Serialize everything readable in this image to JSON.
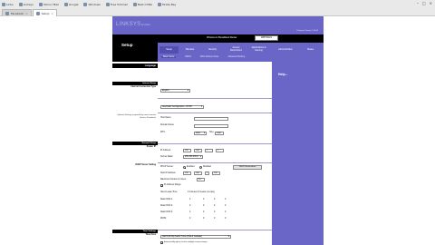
{
  "browser": {
    "bookmarks": [
      {
        "label": "Links"
      },
      {
        "label": "Linksys"
      },
      {
        "label": "Yahoo! Mail"
      },
      {
        "label": "Google"
      },
      {
        "label": "Windows"
      },
      {
        "label": "Free Hotmail"
      },
      {
        "label": "Best CCNA"
      },
      {
        "label": "Pirate Bay"
      }
    ],
    "tabs": [
      {
        "label": "Facebook",
        "active": false
      },
      {
        "label": "Setup",
        "active": true
      }
    ]
  },
  "router": {
    "brand": "LINKSYS",
    "brand_sub": "by Cisco",
    "firmware": "Firmware Version: 1.00.00",
    "section_title": "Setup",
    "product_name": "Wireless-G Broadband Router",
    "model": "WRT54GS",
    "nav_tabs": [
      {
        "label": "Setup",
        "active": true
      },
      {
        "label": "Wireless",
        "active": false
      },
      {
        "label": "Security",
        "active": false
      },
      {
        "label": "Access Restrictions",
        "active": false
      },
      {
        "label": "Applications & Gaming",
        "active": false
      },
      {
        "label": "Administration",
        "active": false
      },
      {
        "label": "Status",
        "active": false
      }
    ],
    "sub_tabs": [
      {
        "label": "Basic Setup",
        "active": true
      },
      {
        "label": "DDNS",
        "active": false
      },
      {
        "label": "MAC Address Clone",
        "active": false
      },
      {
        "label": "Advanced Routing",
        "active": false
      }
    ],
    "help_link": "Help...",
    "left": {
      "language_section": "Language",
      "internet_section": "Internet Setup",
      "internet_conn_type": "Internet Connection Type",
      "optional_settings": "Optional Settings (required by some Internet Service Providers)",
      "network_section": "Network Setup",
      "router_ip": "Router IP",
      "dhcp_settings": "DHCP Server Setting",
      "time_section": "Time Settings",
      "time_zone": "Time Zone"
    },
    "form": {
      "language_value": "English",
      "connection_type": "Automatic Configuration - DHCP",
      "host_name_label": "Host Name:",
      "domain_name_label": "Domain Name:",
      "mtu_label": "MTU:",
      "mtu_mode": "Auto",
      "size_label": "Size:",
      "size_value": "1500",
      "ip_label": "IP Address:",
      "ip": [
        "192",
        "168",
        "1",
        "1"
      ],
      "subnet_label": "Subnet Mask:",
      "subnet_value": "255.255.255.0",
      "dhcp_label": "DHCP Server:",
      "dhcp_enabled": "Enabled",
      "dhcp_disabled": "Disabled",
      "dhcp_reservation": "DHCP Reservation",
      "start_ip_label": "Start IP Address:",
      "start_ip": [
        "192",
        "168",
        "1",
        "100"
      ],
      "max_users_label": "Maximum Number of Users:",
      "max_users": "50",
      "ip_range_label": "IP Address Range:",
      "client_lease_label": "Client Lease Time:",
      "client_lease_note": "0 minutes (0 means one day)",
      "dns1_label": "Static DNS 1:",
      "dns2_label": "Static DNS 2:",
      "dns3_label": "Static DNS 3:",
      "wins_label": "WINS:",
      "dns_zero": "0",
      "time_zone_value": "(GMT-08:00) Pacific Time (USA & Canada)",
      "dst_label": "Automatically adjust clock for daylight saving changes"
    }
  }
}
